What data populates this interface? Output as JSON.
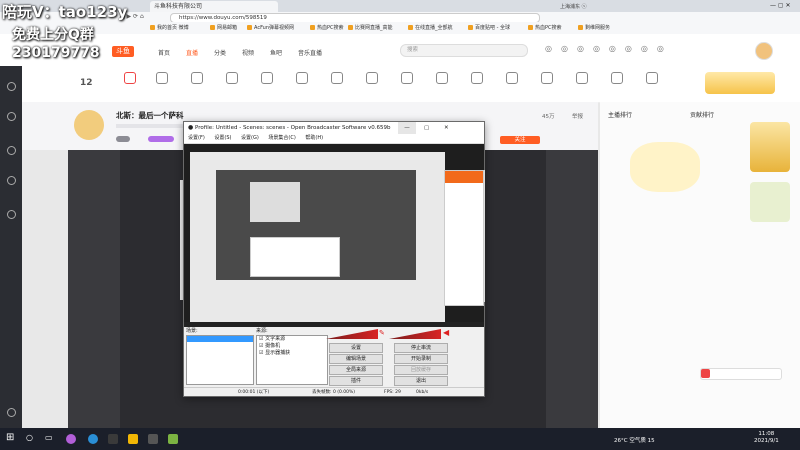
{
  "overlay": {
    "line1": "陪玩V：tao123y",
    "line2": "免费上分Q群",
    "line3": "230179778"
  },
  "browser": {
    "tab_title": "斗鱼科技有限公司",
    "url": "https://www.douyu.com/598519",
    "bookmarks": [
      "我的首页 微博",
      "网易邮箱",
      "AcFun弹幕视频网",
      "热血PC搜索",
      "比赛网直播_高能",
      "在线直播_全部航",
      "百度贴吧 - 全球",
      "热血PC搜索",
      "剩维网服务"
    ]
  },
  "site": {
    "logo": "斗鱼",
    "nav": [
      "首页",
      "直播",
      "分类",
      "视频",
      "鱼吧",
      "音乐直播"
    ],
    "search_placeholder": "搜索",
    "level_num": "12"
  },
  "room": {
    "title": "北斯：最后一个萨科",
    "follow_label": "关注",
    "follow_count": "45万",
    "report": "举报"
  },
  "obs": {
    "title": "Profile: Untitled - Scenes: scenes - Open Broadcaster Software v0.659b",
    "menu": [
      "设置(F)",
      "设置(S)",
      "设置(G)",
      "场景集合(C)",
      "帮助(H)"
    ],
    "scenes_label": "场景:",
    "sources_label": "来源:",
    "sources": [
      "文字来源",
      "摄像机",
      "显示器捕获"
    ],
    "buttons": [
      "设置",
      "停止串流",
      "编辑场景",
      "开始录制",
      "全局来源",
      "回放缓存",
      "插件",
      "退出"
    ],
    "status_time": "0:00:01 (以下)",
    "status_drop": "丢失帧数: 0 (0.00%)",
    "status_fps": "FPS: 29",
    "status_kbps": "0kb/s"
  },
  "right_panel": {
    "tab1": "主播排行",
    "tab2": "贡献排行"
  },
  "taskbar": {
    "weather": "26°C 空气质 15",
    "time": "11:08",
    "date": "2021/9/1"
  }
}
